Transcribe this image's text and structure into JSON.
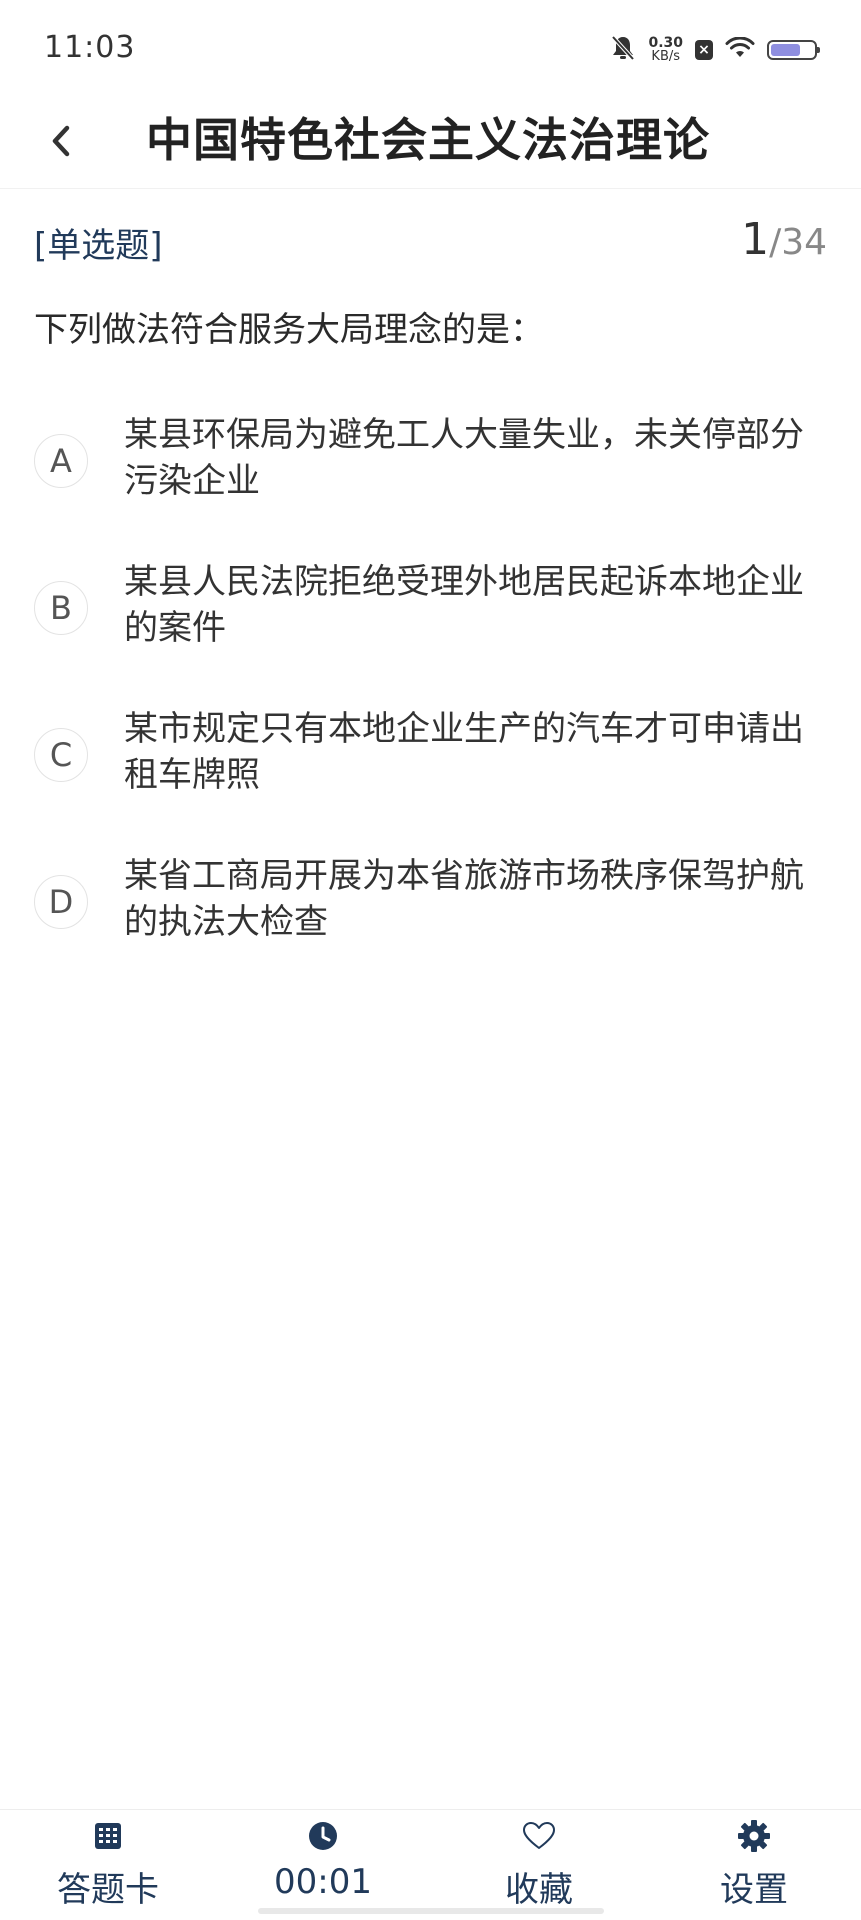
{
  "status_bar": {
    "time": "11:03",
    "net_speed_value": "0.30",
    "net_speed_unit": "KB/s",
    "sim_badge": "×",
    "battery_level": 0.7,
    "battery_color": "#8f8fe0"
  },
  "header": {
    "title": "中国特色社会主义法治理论",
    "back_icon": "chevron-left-icon"
  },
  "question": {
    "type_label": "[单选题]",
    "current": "1",
    "total": "/34",
    "text": "下列做法符合服务大局理念的是："
  },
  "options": [
    {
      "key": "A",
      "text": "某县环保局为避免工人大量失业，未关停部分污染企业"
    },
    {
      "key": "B",
      "text": "某县人民法院拒绝受理外地居民起诉本地企业的案件"
    },
    {
      "key": "C",
      "text": "某市规定只有本地企业生产的汽车才可申请出租车牌照"
    },
    {
      "key": "D",
      "text": "某省工商局开展为本省旅游市场秩序保驾护航的执法大检查"
    }
  ],
  "tabbar": {
    "answer_card": {
      "label": "答题卡",
      "icon": "grid-calendar-icon"
    },
    "timer": {
      "label": "00:01",
      "icon": "clock-icon"
    },
    "favorite": {
      "label": "收藏",
      "icon": "heart-icon"
    },
    "settings": {
      "label": "设置",
      "icon": "gear-icon"
    }
  },
  "colors": {
    "accent": "#213a5a",
    "text": "#333333"
  }
}
